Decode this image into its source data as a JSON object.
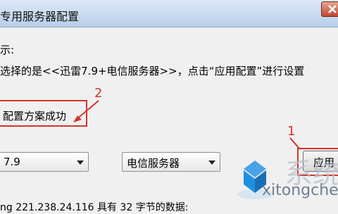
{
  "window": {
    "title": "专用服务器配置"
  },
  "main": {
    "hint_label": "示:",
    "hint_text": "选择的是<<迅雷7.9+电信服务器>>，点击“应用配置”进行设置",
    "success_message": "配置方案成功",
    "version_select_value": "7.9",
    "server_select_value": "电信服务器",
    "apply_button_label": "应用",
    "footer_status": "ng 221.238.24.116 具有 32 字节的数据:"
  },
  "annotations": {
    "marker_1": "1",
    "marker_2": "2"
  },
  "watermark": {
    "site_text": "系统",
    "domain_text": "xitongche"
  },
  "colors": {
    "annotation": "#d5342a",
    "titlebar": "#c9dcf1",
    "logo_blue": "#1f8fe0"
  }
}
